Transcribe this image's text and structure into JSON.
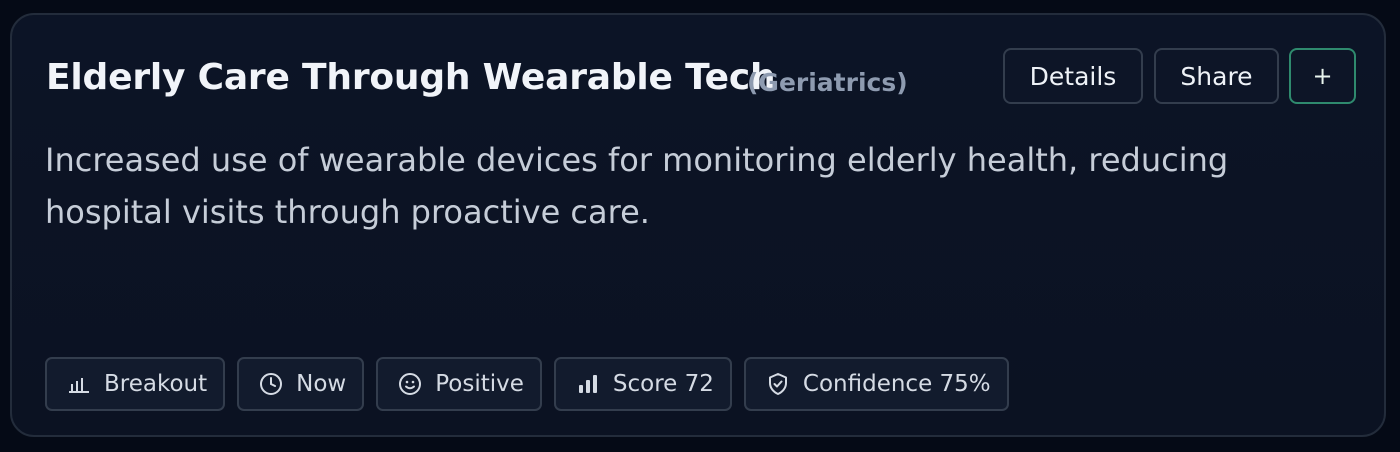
{
  "card": {
    "title": "Elderly Care Through Wearable Tech",
    "category": "(Geriatrics)",
    "summary": "Increased use of wearable devices for monitoring elderly health, reducing hospital visits through proactive care."
  },
  "actions": {
    "details_label": "Details",
    "share_label": "Share",
    "add_label": "+"
  },
  "chips": [
    {
      "icon": "bar-chart-icon",
      "label": "Breakout"
    },
    {
      "icon": "clock-icon",
      "label": "Now"
    },
    {
      "icon": "smiley-icon",
      "label": "Positive"
    },
    {
      "icon": "signal-bars-icon",
      "label": "Score 72"
    },
    {
      "icon": "shield-check-icon",
      "label": "Confidence 75%"
    }
  ],
  "colors": {
    "background": "#050a16",
    "card": "#0c1426",
    "border": "#333d4d",
    "accent": "#2f8a6e"
  }
}
